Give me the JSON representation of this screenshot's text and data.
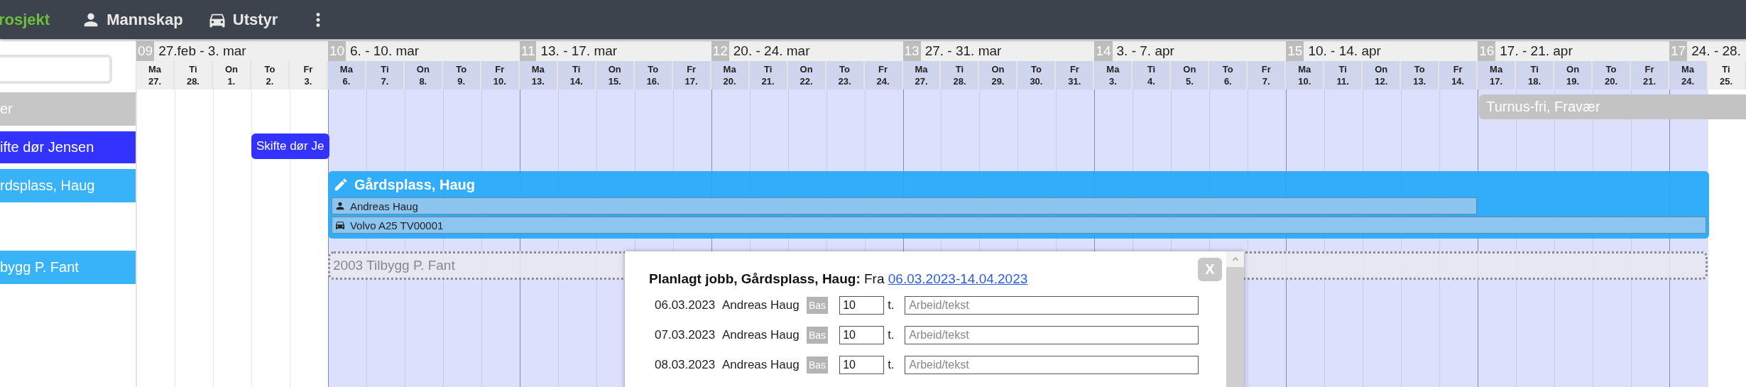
{
  "nav": {
    "items": [
      {
        "label": "rosjekt",
        "selected": true
      },
      {
        "label": "Mannskap",
        "selected": false
      },
      {
        "label": "Utstyr",
        "selected": false
      }
    ]
  },
  "sidebar": {
    "rows": [
      {
        "label": "er",
        "color": "#c6c6c6"
      },
      {
        "label": "ifte dør Jensen",
        "color": "#3333ff"
      },
      {
        "label": "rdsplass, Haug",
        "color": "#39b3f7"
      },
      {
        "label": "bygg P. Fant",
        "color": "#39b3f7"
      }
    ]
  },
  "weeks": [
    {
      "number": "09",
      "label": "27.feb - 3. mar",
      "days": [
        {
          "weekday": "Ma",
          "date": "27.",
          "in_period": false
        },
        {
          "weekday": "Ti",
          "date": "28.",
          "in_period": false
        },
        {
          "weekday": "On",
          "date": "1.",
          "in_period": false
        },
        {
          "weekday": "To",
          "date": "2.",
          "in_period": false
        },
        {
          "weekday": "Fr",
          "date": "3.",
          "in_period": false
        }
      ]
    },
    {
      "number": "10",
      "label": "6. - 10. mar",
      "days": [
        {
          "weekday": "Ma",
          "date": "6.",
          "in_period": true
        },
        {
          "weekday": "Ti",
          "date": "7.",
          "in_period": true
        },
        {
          "weekday": "On",
          "date": "8.",
          "in_period": true
        },
        {
          "weekday": "To",
          "date": "9.",
          "in_period": true
        },
        {
          "weekday": "Fr",
          "date": "10.",
          "in_period": true
        }
      ]
    },
    {
      "number": "11",
      "label": "13. - 17. mar",
      "days": [
        {
          "weekday": "Ma",
          "date": "13.",
          "in_period": true
        },
        {
          "weekday": "Ti",
          "date": "14.",
          "in_period": true
        },
        {
          "weekday": "On",
          "date": "15.",
          "in_period": true
        },
        {
          "weekday": "To",
          "date": "16.",
          "in_period": true
        },
        {
          "weekday": "Fr",
          "date": "17.",
          "in_period": true
        }
      ]
    },
    {
      "number": "12",
      "label": "20. - 24. mar",
      "days": [
        {
          "weekday": "Ma",
          "date": "20.",
          "in_period": true
        },
        {
          "weekday": "Ti",
          "date": "21.",
          "in_period": true
        },
        {
          "weekday": "On",
          "date": "22.",
          "in_period": true
        },
        {
          "weekday": "To",
          "date": "23.",
          "in_period": true
        },
        {
          "weekday": "Fr",
          "date": "24.",
          "in_period": true
        }
      ]
    },
    {
      "number": "13",
      "label": "27. - 31. mar",
      "days": [
        {
          "weekday": "Ma",
          "date": "27.",
          "in_period": true
        },
        {
          "weekday": "Ti",
          "date": "28.",
          "in_period": true
        },
        {
          "weekday": "On",
          "date": "29.",
          "in_period": true
        },
        {
          "weekday": "To",
          "date": "30.",
          "in_period": true
        },
        {
          "weekday": "Fr",
          "date": "31.",
          "in_period": true
        }
      ]
    },
    {
      "number": "14",
      "label": "3. - 7. apr",
      "days": [
        {
          "weekday": "Ma",
          "date": "3.",
          "in_period": true
        },
        {
          "weekday": "Ti",
          "date": "4.",
          "in_period": true
        },
        {
          "weekday": "On",
          "date": "5.",
          "in_period": true
        },
        {
          "weekday": "To",
          "date": "6.",
          "in_period": true
        },
        {
          "weekday": "Fr",
          "date": "7.",
          "in_period": true
        }
      ]
    },
    {
      "number": "15",
      "label": "10. - 14. apr",
      "days": [
        {
          "weekday": "Ma",
          "date": "10.",
          "in_period": true
        },
        {
          "weekday": "Ti",
          "date": "11.",
          "in_period": true
        },
        {
          "weekday": "On",
          "date": "12.",
          "in_period": true
        },
        {
          "weekday": "To",
          "date": "13.",
          "in_period": true
        },
        {
          "weekday": "Fr",
          "date": "14.",
          "in_period": true
        }
      ]
    },
    {
      "number": "16",
      "label": "17. - 21. apr",
      "days": [
        {
          "weekday": "Ma",
          "date": "17.",
          "in_period": true
        },
        {
          "weekday": "Ti",
          "date": "18.",
          "in_period": true
        },
        {
          "weekday": "On",
          "date": "19.",
          "in_period": true
        },
        {
          "weekday": "To",
          "date": "20.",
          "in_period": true
        },
        {
          "weekday": "Fr",
          "date": "21.",
          "in_period": true
        }
      ]
    },
    {
      "number": "17",
      "label": "24. - 28.",
      "days": [
        {
          "weekday": "Ma",
          "date": "24.",
          "in_period": true
        },
        {
          "weekday": "Ti",
          "date": "25.",
          "in_period": false
        }
      ]
    }
  ],
  "events": [
    {
      "kind": "absence",
      "title": "Turnus-fri, Fravær"
    },
    {
      "kind": "job",
      "title": "Skifte dør Je"
    },
    {
      "kind": "planned",
      "title": "Gårdsplass, Haug",
      "resources": [
        {
          "kind": "crew",
          "label": "Andreas Haug"
        },
        {
          "kind": "equipment",
          "label": "Volvo A25 TV00001"
        }
      ]
    },
    {
      "kind": "placeholder",
      "title": "2003 Tilbygg P. Fant"
    }
  ],
  "popup": {
    "title": "Planlagt jobb, Gårdsplass, Haug:",
    "from": "Fra",
    "range": "06.03.2023-14.04.2023",
    "close": "X",
    "rows": [
      {
        "date": "06.03.2023",
        "name": "Andreas Haug",
        "tag": "Bas",
        "hours": "10",
        "unit": "t.",
        "placeholder": "Arbeid/tekst"
      },
      {
        "date": "07.03.2023",
        "name": "Andreas Haug",
        "tag": "Bas",
        "hours": "10",
        "unit": "t.",
        "placeholder": "Arbeid/tekst"
      },
      {
        "date": "08.03.2023",
        "name": "Andreas Haug",
        "tag": "Bas",
        "hours": "10",
        "unit": "t.",
        "placeholder": "Arbeid/tekst"
      }
    ]
  }
}
